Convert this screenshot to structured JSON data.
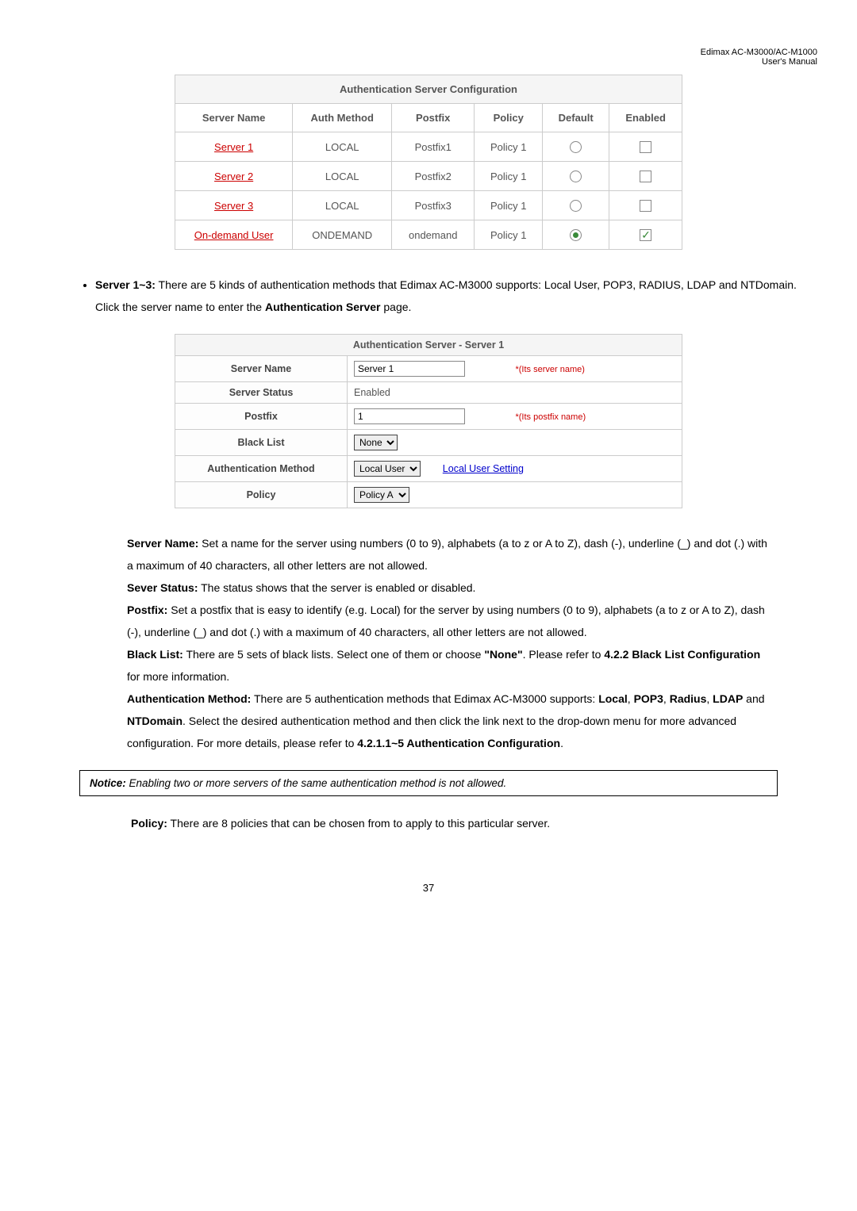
{
  "header": {
    "line1": "Edimax AC-M3000/AC-M1000",
    "line2": "User's Manual"
  },
  "authTable": {
    "title": "Authentication Server Configuration",
    "headers": [
      "Server Name",
      "Auth Method",
      "Postfix",
      "Policy",
      "Default",
      "Enabled"
    ],
    "rows": [
      {
        "name": "Server 1",
        "method": "LOCAL",
        "postfix": "Postfix1",
        "policy": "Policy 1",
        "default": false,
        "enabled": false
      },
      {
        "name": "Server 2",
        "method": "LOCAL",
        "postfix": "Postfix2",
        "policy": "Policy 1",
        "default": false,
        "enabled": false
      },
      {
        "name": "Server 3",
        "method": "LOCAL",
        "postfix": "Postfix3",
        "policy": "Policy 1",
        "default": false,
        "enabled": false
      },
      {
        "name": "On-demand User",
        "method": "ONDEMAND",
        "postfix": "ondemand",
        "policy": "Policy 1",
        "default": true,
        "enabled": true
      }
    ]
  },
  "bullet": {
    "label": "Server 1~3:",
    "text_part1": " There are 5 kinds of authentication methods that Edimax AC-M3000 supports: Local User, POP3, RADIUS, LDAP and NTDomain. Click the server name to enter the ",
    "text_bold": "Authentication Server",
    "text_part2": " page."
  },
  "serverForm": {
    "title": "Authentication Server - Server 1",
    "rows": {
      "serverName": {
        "label": "Server Name",
        "value": "Server 1",
        "hint": "*(Its server name)"
      },
      "serverStatus": {
        "label": "Server Status",
        "value": "Enabled"
      },
      "postfix": {
        "label": "Postfix",
        "value": "1",
        "hint": "*(Its postfix name)"
      },
      "blackList": {
        "label": "Black List",
        "value": "None"
      },
      "authMethod": {
        "label": "Authentication Method",
        "value": "Local User",
        "link": "Local User Setting"
      },
      "policy": {
        "label": "Policy",
        "value": "Policy A"
      }
    }
  },
  "defs": {
    "serverName": {
      "label": "Server Name:",
      "text": " Set a name for the server using numbers (0 to 9), alphabets (a to z or A to Z), dash (-), underline (_) and dot (.) with a maximum of 40 characters, all other letters are not allowed."
    },
    "severStatus": {
      "label": "Sever Status:",
      "text": " The status shows that the server is enabled or disabled."
    },
    "postfix": {
      "label": "Postfix:",
      "text": " Set a postfix that is easy to identify (e.g. Local) for the server by using numbers (0 to 9), alphabets (a to z or A to Z), dash (-), underline (_) and dot (.) with a maximum of 40 characters, all other letters are not allowed."
    },
    "blackList": {
      "label": "Black List:",
      "text_a": " There are 5 sets of black lists. Select one of them or choose ",
      "bold_a": "\"None\"",
      "text_b": ". Please refer to ",
      "bold_b": "4.2.2 Black List Configuration",
      "text_c": " for more information."
    },
    "authMethod": {
      "label": "Authentication Method:",
      "text_a": " There are 5 authentication methods that Edimax AC-M3000 supports: ",
      "bold_a": "Local",
      "sep": ", ",
      "bold_b": "POP3",
      "bold_c": "Radius",
      "bold_d": "LDAP",
      "and": " and ",
      "bold_e": "NTDomain",
      "text_b": ". Select the desired authentication method and then click the link next to the drop-down menu for more advanced configuration. For more details, please refer to ",
      "bold_f": "4.2.1.1~5 Authentication Configuration",
      "text_c": "."
    }
  },
  "notice": {
    "label": "Notice:",
    "text": " Enabling two or more servers of the same authentication method is not allowed."
  },
  "policyLine": {
    "label": "Policy:",
    "text": " There are 8 policies that can be chosen from to apply to this particular server."
  },
  "pageNum": "37"
}
